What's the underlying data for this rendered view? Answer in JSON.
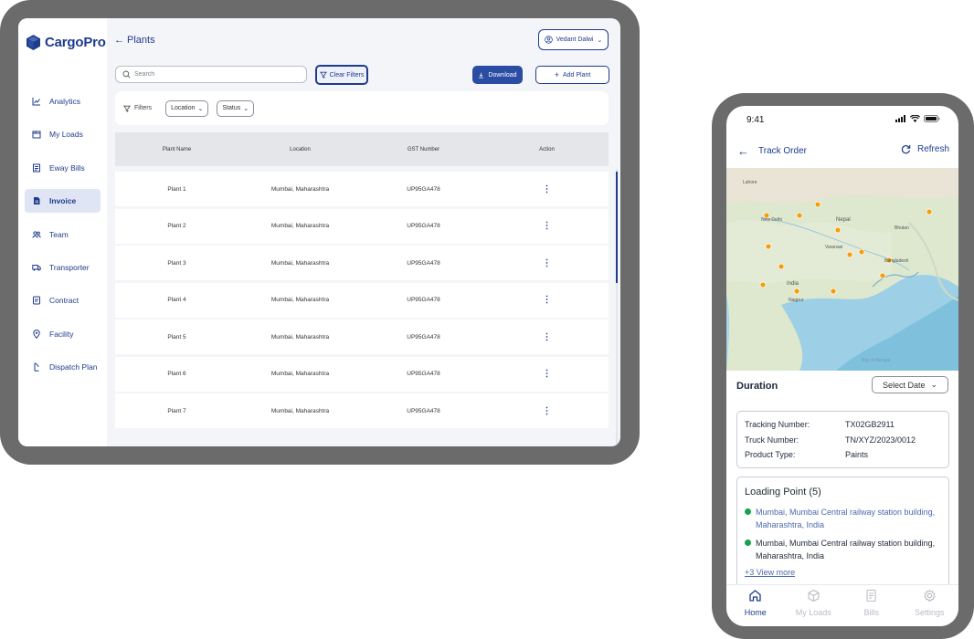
{
  "app": {
    "name": "CargoPro",
    "brand_color": "#1f3b8c"
  },
  "sidebar": {
    "items": [
      {
        "label": "Analytics",
        "icon": "chart-line-icon"
      },
      {
        "label": "My Loads",
        "icon": "box-icon"
      },
      {
        "label": "Eway Bills",
        "icon": "receipt-icon"
      },
      {
        "label": "Invoice",
        "icon": "document-icon",
        "active": true
      },
      {
        "label": "Team",
        "icon": "team-icon"
      },
      {
        "label": "Transporter",
        "icon": "truck-icon"
      },
      {
        "label": "Contract",
        "icon": "contract-icon"
      },
      {
        "label": "Facility",
        "icon": "location-pin-icon"
      },
      {
        "label": "Dispatch Plan",
        "icon": "dispatch-icon"
      }
    ]
  },
  "header": {
    "title": "Plants",
    "user_name": "Vedant Dalwi"
  },
  "toolbar": {
    "search_placeholder": "Search",
    "clear_filters_label": "Clear Filters",
    "download_label": "Download",
    "add_plant_label": "Add Plant"
  },
  "filters": {
    "label": "Filters",
    "chips": [
      "Location",
      "Status"
    ]
  },
  "table": {
    "columns": [
      "Plant Name",
      "Location",
      "GST Number",
      "Action"
    ],
    "rows": [
      {
        "name": "Plant 1",
        "location": "Mumbai, Maharashtra",
        "gst": "UP95GA478"
      },
      {
        "name": "Plant 2",
        "location": "Mumbai, Maharashtra",
        "gst": "UP95GA478"
      },
      {
        "name": "Plant 3",
        "location": "Mumbai, Maharashtra",
        "gst": "UP95GA478"
      },
      {
        "name": "Plant 4",
        "location": "Mumbai, Maharashtra",
        "gst": "UP95GA478"
      },
      {
        "name": "Plant 5",
        "location": "Mumbai, Maharashtra",
        "gst": "UP95GA478"
      },
      {
        "name": "Plant 6",
        "location": "Mumbai, Maharashtra",
        "gst": "UP95GA478"
      },
      {
        "name": "Plant 7",
        "location": "Mumbai, Maharashtra",
        "gst": "UP95GA478"
      }
    ],
    "action_glyph": "⋮"
  },
  "phone": {
    "time": "9:41",
    "title": "Track Order",
    "refresh_label": "Refresh",
    "map_labels": [
      "Lahore",
      "New Delhi",
      "Nepal",
      "Bhutan",
      "Varanasi",
      "Bangladesh",
      "India",
      "Nagpur",
      "Bay of Bengal"
    ],
    "duration_label": "Duration",
    "date_select": "Select Date",
    "tracking": [
      {
        "key": "Tracking Number:",
        "value": "TX02GB2911"
      },
      {
        "key": "Truck  Number:",
        "value": "TN/XYZ/2023/0012"
      },
      {
        "key": "Product Type:",
        "value": "Paints"
      }
    ],
    "loading_title": "Loading Point (5)",
    "loading_points": [
      "Mumbai, Mumbai Central railway station building, Maharashtra, India",
      "Mumbai, Mumbai Central railway  station building, Maharashtra, India"
    ],
    "view_more": "+3 View more",
    "tabs": [
      {
        "label": "Home",
        "icon": "home-icon",
        "active": true
      },
      {
        "label": "My Loads",
        "icon": "box-icon"
      },
      {
        "label": "Bills",
        "icon": "bills-icon"
      },
      {
        "label": "Settings",
        "icon": "gear-icon"
      }
    ]
  }
}
